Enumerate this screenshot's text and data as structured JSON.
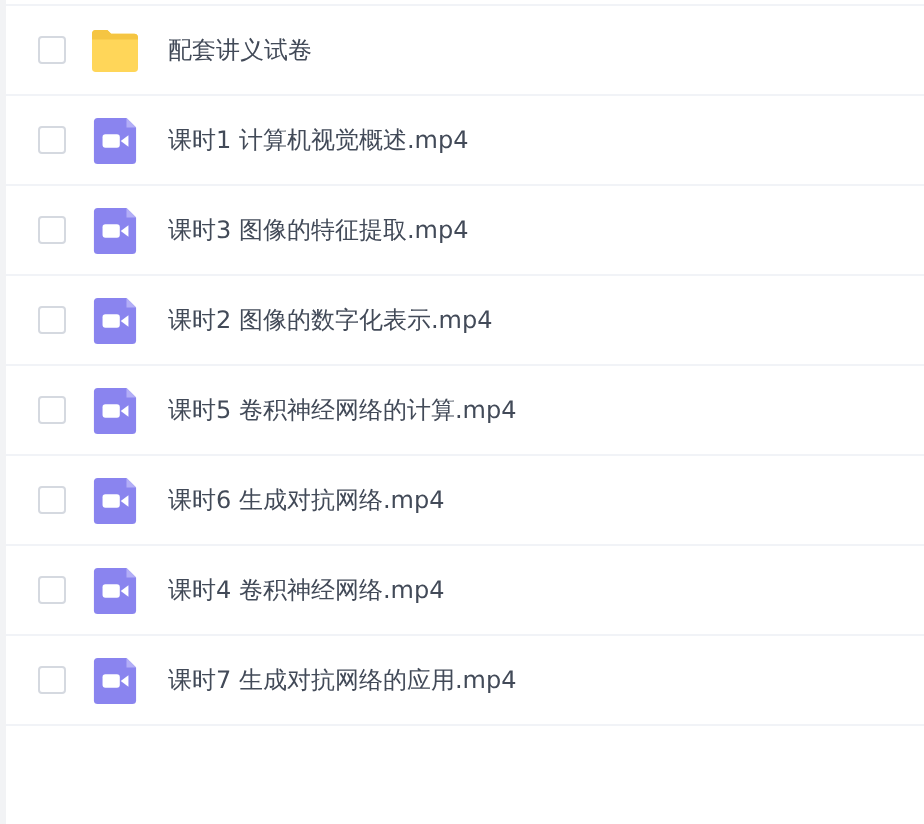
{
  "files": [
    {
      "kind": "folder",
      "name": "配套讲义试卷",
      "checked": false
    },
    {
      "kind": "video",
      "name": "课时1 计算机视觉概述.mp4",
      "checked": false
    },
    {
      "kind": "video",
      "name": "课时3 图像的特征提取.mp4",
      "checked": false
    },
    {
      "kind": "video",
      "name": "课时2 图像的数字化表示.mp4",
      "checked": false
    },
    {
      "kind": "video",
      "name": "课时5 卷积神经网络的计算.mp4",
      "checked": false
    },
    {
      "kind": "video",
      "name": "课时6 生成对抗网络.mp4",
      "checked": false
    },
    {
      "kind": "video",
      "name": "课时4 卷积神经网络.mp4",
      "checked": false
    },
    {
      "kind": "video",
      "name": "课时7 生成对抗网络的应用.mp4",
      "checked": false
    }
  ]
}
